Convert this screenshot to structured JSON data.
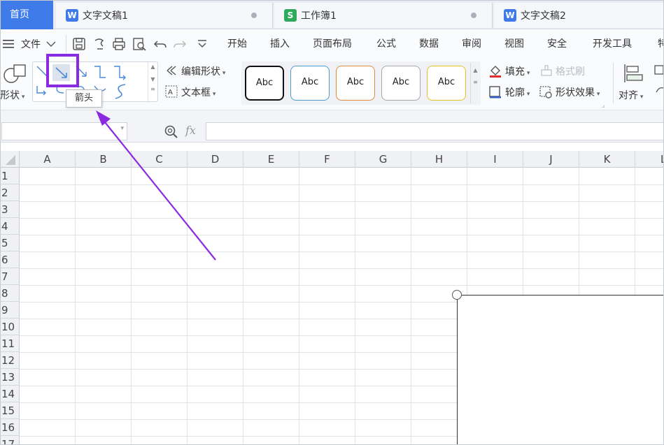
{
  "tabs": {
    "home": "首页",
    "docs": [
      {
        "label": "文字文稿1",
        "badge": "W",
        "color": "#3e7be8"
      },
      {
        "label": "工作簿1",
        "badge": "S",
        "color": "#2eaa5c"
      },
      {
        "label": "文字文稿2",
        "badge": "W",
        "color": "#3e7be8"
      }
    ]
  },
  "menu": {
    "file": "文件",
    "items": [
      "开始",
      "插入",
      "页面布局",
      "公式",
      "数据",
      "审阅",
      "视图",
      "安全",
      "开发工具",
      "特"
    ]
  },
  "ribbon": {
    "shape_label": "形状",
    "edit_shape": "编辑形状",
    "textbox": "文本框",
    "style_label": "Abc",
    "fill": "填充",
    "format_painter": "格式刷",
    "outline": "轮廓",
    "shape_effect": "形状效果",
    "align": "对齐",
    "tooltip": "箭头"
  },
  "formula": {
    "fx": "fx"
  },
  "grid": {
    "columns": [
      "A",
      "B",
      "C",
      "D",
      "E",
      "F",
      "G",
      "H",
      "I",
      "J",
      "K",
      "L"
    ],
    "rows": [
      "1",
      "2",
      "3",
      "4",
      "5",
      "6",
      "7",
      "8",
      "9",
      "10",
      "11",
      "12",
      "13",
      "14",
      "15",
      "16",
      "17"
    ]
  },
  "colors": {
    "accent": "#3e7be8",
    "highlight": "#8a2be2",
    "excel_green": "#2eaa5c"
  }
}
